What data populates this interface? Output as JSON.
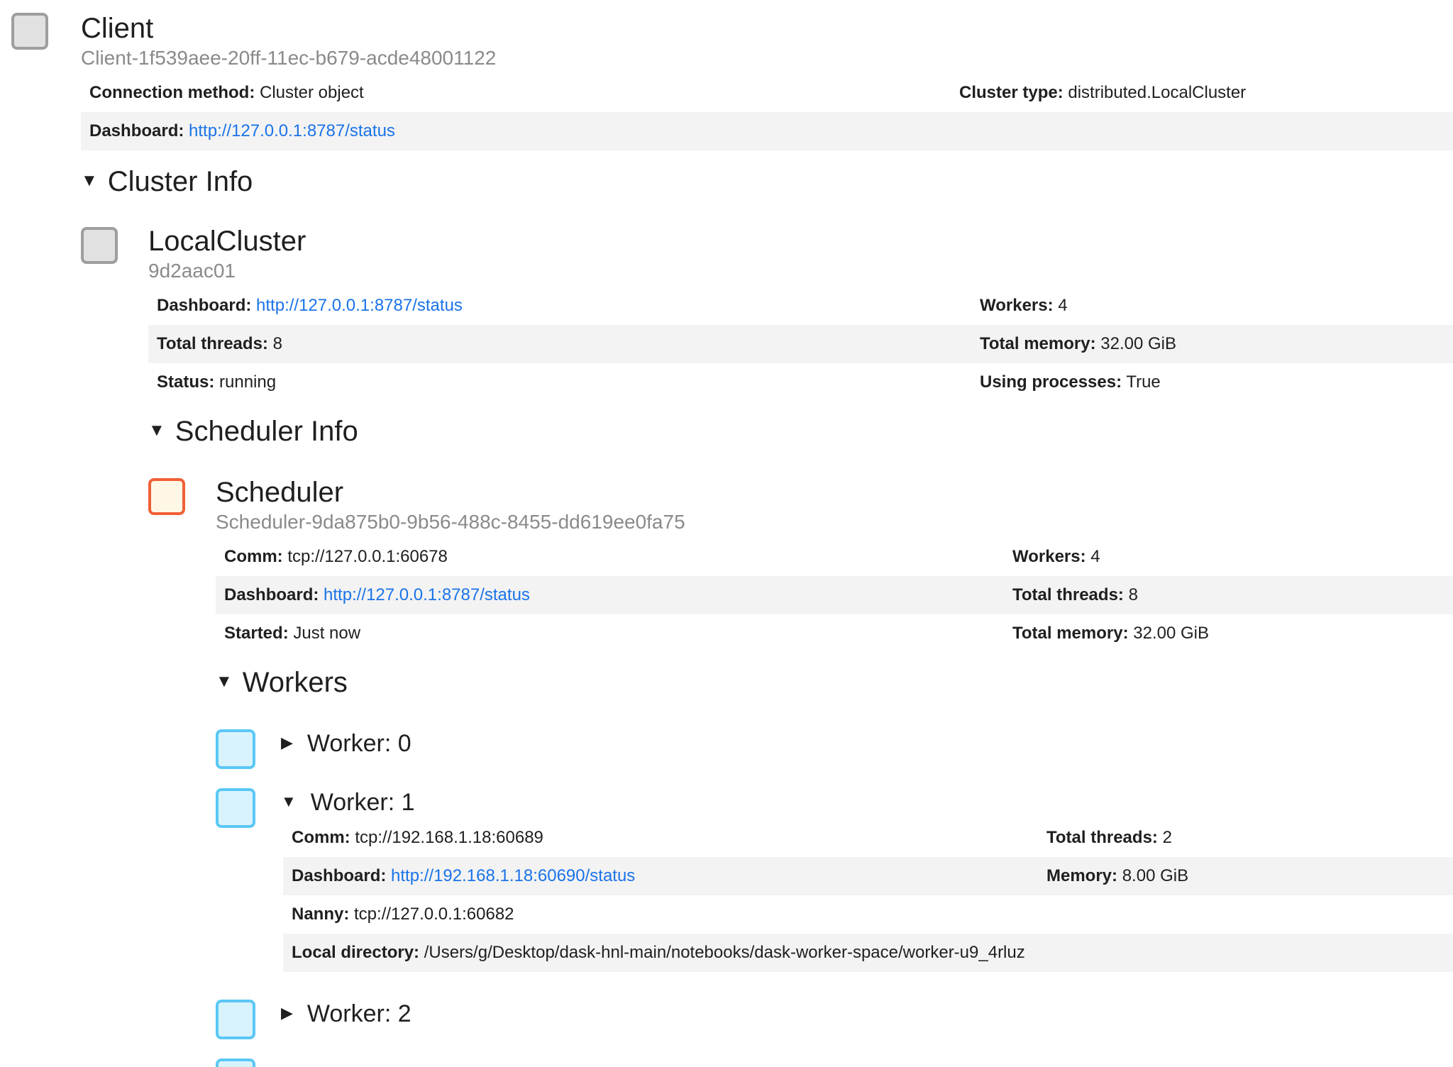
{
  "client": {
    "title": "Client",
    "id": "Client-1f539aee-20ff-11ec-b679-acde48001122",
    "connection_method_label": "Connection method:",
    "connection_method_value": "Cluster object",
    "cluster_type_label": "Cluster type:",
    "cluster_type_value": "distributed.LocalCluster",
    "dashboard_label": "Dashboard:",
    "dashboard_link": "http://127.0.0.1:8787/status"
  },
  "cluster_info": {
    "caret": "▼",
    "heading": "Cluster Info",
    "title": "LocalCluster",
    "id": "9d2aac01",
    "dashboard_label": "Dashboard:",
    "dashboard_link": "http://127.0.0.1:8787/status",
    "workers_label": "Workers:",
    "workers_value": "4",
    "threads_label": "Total threads:",
    "threads_value": "8",
    "memory_label": "Total memory:",
    "memory_value": "32.00 GiB",
    "status_label": "Status:",
    "status_value": "running",
    "processes_label": "Using processes:",
    "processes_value": "True"
  },
  "scheduler_info": {
    "caret": "▼",
    "heading": "Scheduler Info",
    "title": "Scheduler",
    "id": "Scheduler-9da875b0-9b56-488c-8455-dd619ee0fa75",
    "comm_label": "Comm:",
    "comm_value": "tcp://127.0.0.1:60678",
    "workers_label": "Workers:",
    "workers_value": "4",
    "dashboard_label": "Dashboard:",
    "dashboard_link": "http://127.0.0.1:8787/status",
    "threads_label": "Total threads:",
    "threads_value": "8",
    "started_label": "Started:",
    "started_value": "Just now",
    "memory_label": "Total memory:",
    "memory_value": "32.00 GiB"
  },
  "workers": {
    "caret": "▼",
    "heading": "Workers",
    "worker0": {
      "caret": "▶",
      "title": "Worker: 0"
    },
    "worker1": {
      "caret": "▼",
      "title": "Worker: 1",
      "comm_label": "Comm:",
      "comm_value": "tcp://192.168.1.18:60689",
      "threads_label": "Total threads:",
      "threads_value": "2",
      "dashboard_label": "Dashboard:",
      "dashboard_link": "http://192.168.1.18:60690/status",
      "memory_label": "Memory:",
      "memory_value": "8.00 GiB",
      "nanny_label": "Nanny:",
      "nanny_value": "tcp://127.0.0.1:60682",
      "local_dir_label": "Local directory:",
      "local_dir_value": "/Users/g/Desktop/dask-hnl-main/notebooks/dask-worker-space/worker-u9_4rluz"
    },
    "worker2": {
      "caret": "▶",
      "title": "Worker: 2"
    }
  },
  "colors": {
    "client_icon": "#9e9e9e",
    "scheduler_icon": "#f05f37",
    "worker_icon": "#5ac8f5",
    "link": "#1a73e8"
  }
}
